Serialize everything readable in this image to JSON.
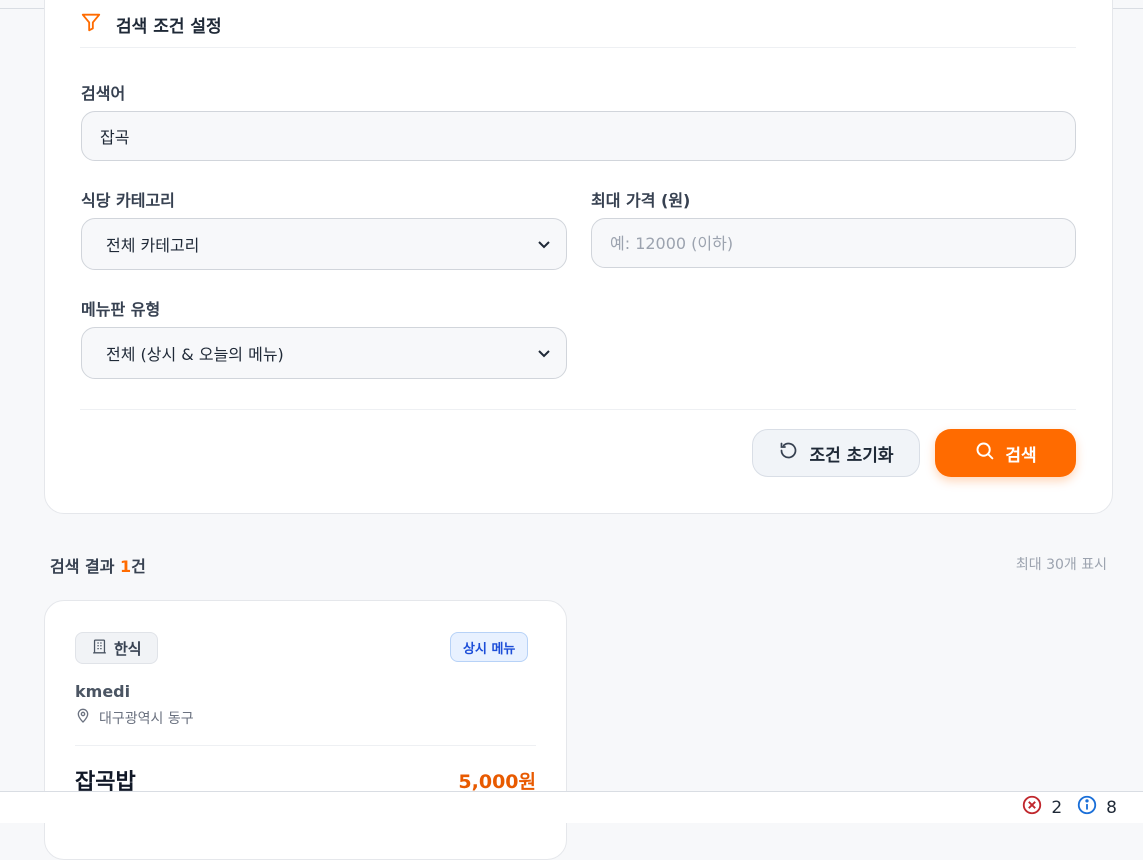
{
  "panel": {
    "title": "검색 조건 설정",
    "keyword_label": "검색어",
    "keyword_value": "잡곡",
    "category_label": "식당 카테고리",
    "category_selected": "전체 카테고리",
    "price_label": "최대 가격 (원)",
    "price_placeholder": "예: 12000 (이하)",
    "menu_type_label": "메뉴판 유형",
    "menu_type_selected": "전체 (상시 & 오늘의 메뉴)",
    "reset_label": "조건 초기화",
    "search_label": "검색"
  },
  "results": {
    "prefix": "검색 결과 ",
    "count": "1",
    "suffix": "건",
    "note": "최대 30개 표시",
    "items": [
      {
        "category": "한식",
        "menu_type": "상시 메뉴",
        "restaurant": "kmedi",
        "location": "대구광역시 동구",
        "menu_name": "잡곡밥",
        "price": "5,000원"
      }
    ]
  },
  "status_bar": {
    "errors": "2",
    "infos": "8"
  },
  "colors": {
    "accent": "#ff6b00",
    "badge_blue": "#1d4ed8"
  }
}
